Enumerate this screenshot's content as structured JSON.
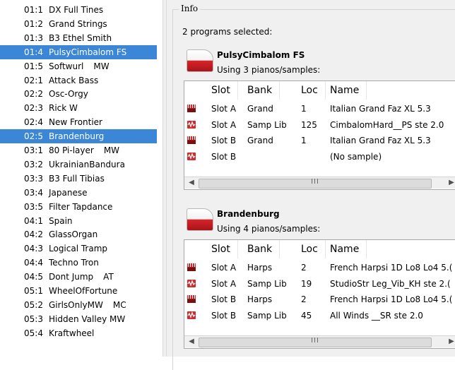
{
  "programs": [
    {
      "num": "01:1",
      "name": "DX Full Tines",
      "suffix": ""
    },
    {
      "num": "01:2",
      "name": "Grand Strings",
      "suffix": ""
    },
    {
      "num": "01:3",
      "name": "B3 Ethel Smith",
      "suffix": ""
    },
    {
      "num": "01:4",
      "name": "PulsyCimbalom FS",
      "suffix": "",
      "selected": true
    },
    {
      "num": "01:5",
      "name": "Softwurl",
      "suffix": "MW"
    },
    {
      "num": "02:1",
      "name": "Attack Bass",
      "suffix": ""
    },
    {
      "num": "02:2",
      "name": "Osc-Orgy",
      "suffix": ""
    },
    {
      "num": "02:3",
      "name": "Rick W",
      "suffix": ""
    },
    {
      "num": "02:4",
      "name": "New Frontier",
      "suffix": ""
    },
    {
      "num": "02:5",
      "name": "Brandenburg",
      "suffix": "",
      "selected": true
    },
    {
      "num": "03:1",
      "name": "80 Pi-layer",
      "suffix": "MW"
    },
    {
      "num": "03:2",
      "name": "UkrainianBandura",
      "suffix": ""
    },
    {
      "num": "03:3",
      "name": "B3 Full Tibias",
      "suffix": ""
    },
    {
      "num": "03:4",
      "name": "Japanese",
      "suffix": ""
    },
    {
      "num": "03:5",
      "name": "Filter Tapdance",
      "suffix": ""
    },
    {
      "num": "04:1",
      "name": "Spain",
      "suffix": ""
    },
    {
      "num": "04:2",
      "name": "GlassOrgan",
      "suffix": ""
    },
    {
      "num": "04:3",
      "name": "Logical Tramp",
      "suffix": ""
    },
    {
      "num": "04:4",
      "name": "Techno Tron",
      "suffix": ""
    },
    {
      "num": "04:5",
      "name": "Dont Jump",
      "suffix": "AT"
    },
    {
      "num": "05:1",
      "name": "WheelOfFortune",
      "suffix": ""
    },
    {
      "num": "05:2",
      "name": "GirlsOnlyMW",
      "suffix": "MC"
    },
    {
      "num": "05:3",
      "name": "Hidden Valley MW",
      "suffix": ""
    },
    {
      "num": "05:4",
      "name": "Kraftwheel",
      "suffix": ""
    }
  ],
  "info": {
    "title": "Info",
    "selected_text": "2 programs selected:",
    "columns": [
      "Slot",
      "Bank",
      "Loc",
      "Name"
    ],
    "blocks": [
      {
        "name": "PulsyCimbalom FS",
        "using": "Using 3 pianos/samples:",
        "rows": [
          {
            "icon": "piano-icon",
            "slot": "Slot A",
            "bank": "Grand",
            "loc": "1",
            "name": "Italian Grand Faz XL 5.3"
          },
          {
            "icon": "sample-icon",
            "slot": "Slot A",
            "bank": "Samp Lib",
            "loc": "125",
            "name": "CimbalomHard__PS ste 2.0"
          },
          {
            "icon": "piano-icon",
            "slot": "Slot B",
            "bank": "Grand",
            "loc": "1",
            "name": "Italian Grand Faz XL 5.3"
          },
          {
            "icon": "sample-icon",
            "slot": "Slot B",
            "bank": "",
            "loc": "",
            "name": "(No sample)"
          }
        ]
      },
      {
        "name": "Brandenburg",
        "using": "Using 4 pianos/samples:",
        "rows": [
          {
            "icon": "piano-icon",
            "slot": "Slot A",
            "bank": "Harps",
            "loc": "2",
            "name": "French Harpsi 1D Lo8 Lo4 5.("
          },
          {
            "icon": "sample-icon",
            "slot": "Slot A",
            "bank": "Samp Lib",
            "loc": "19",
            "name": "StudioStr Leg_Vib_KH ste 2.("
          },
          {
            "icon": "piano-icon",
            "slot": "Slot B",
            "bank": "Harps",
            "loc": "2",
            "name": "French Harpsi 1D Lo8 Lo4 5.("
          },
          {
            "icon": "sample-icon",
            "slot": "Slot B",
            "bank": "Samp Lib",
            "loc": "45",
            "name": "All Winds __SR ste 2.0"
          }
        ]
      }
    ]
  },
  "colors": {
    "selection": "#3b86d6",
    "accent_red": "#d8242a"
  }
}
